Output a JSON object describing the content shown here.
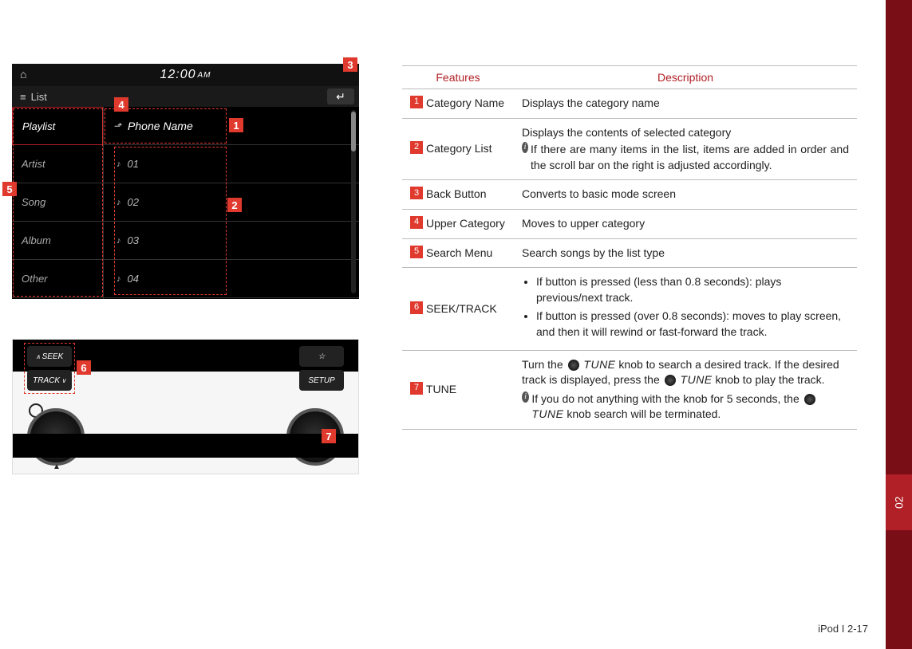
{
  "page": {
    "footer": "iPod I 2-17",
    "tab": "02"
  },
  "screen1": {
    "time": "12:00",
    "ampm": "AM",
    "title": "List",
    "menu": [
      "Playlist",
      "Artist",
      "Song",
      "Album",
      "Other"
    ],
    "phone": "Phone Name",
    "tracks": [
      "01",
      "02",
      "03",
      "04"
    ]
  },
  "screen2": {
    "seek": "SEEK",
    "track": "TRACK",
    "fav": "☆",
    "setup": "SETUP"
  },
  "callouts": {
    "c1": "1",
    "c2": "2",
    "c3": "3",
    "c4": "4",
    "c5": "5",
    "c6": "6",
    "c7": "7"
  },
  "table": {
    "h1": "Features",
    "h2": "Description",
    "rows": [
      {
        "n": "1",
        "f": "Category Name",
        "d": "Displays the category name"
      },
      {
        "n": "2",
        "f": "Category List",
        "d": "Displays the contents of selected category",
        "di": "If there are many items in the list, items are added in order and the scroll bar on the right is adjusted accordingly."
      },
      {
        "n": "3",
        "f": "Back Button",
        "d": "Converts to basic mode screen"
      },
      {
        "n": "4",
        "f": "Upper Category",
        "d": "Moves to upper category"
      },
      {
        "n": "5",
        "f": "Search Menu",
        "d": "Search songs by the list type"
      },
      {
        "n": "6",
        "f": "SEEK/TRACK",
        "b1": "If button is pressed (less than 0.8 seconds): plays previous/next track.",
        "b2": "If button is pressed (over 0.8 seconds): moves to play screen, and then it will rewind or fast-forward the track."
      },
      {
        "n": "7",
        "f": "TUNE",
        "t1a": "Turn the ",
        "t1b": " knob to search a desired track. If the desired track is displayed, press the ",
        "t1c": " knob to play the track.",
        "ti": "If you do not anything with the knob for 5 seconds, the ",
        "tic": " knob search will be terminated.",
        "tune": "TUNE"
      }
    ]
  }
}
